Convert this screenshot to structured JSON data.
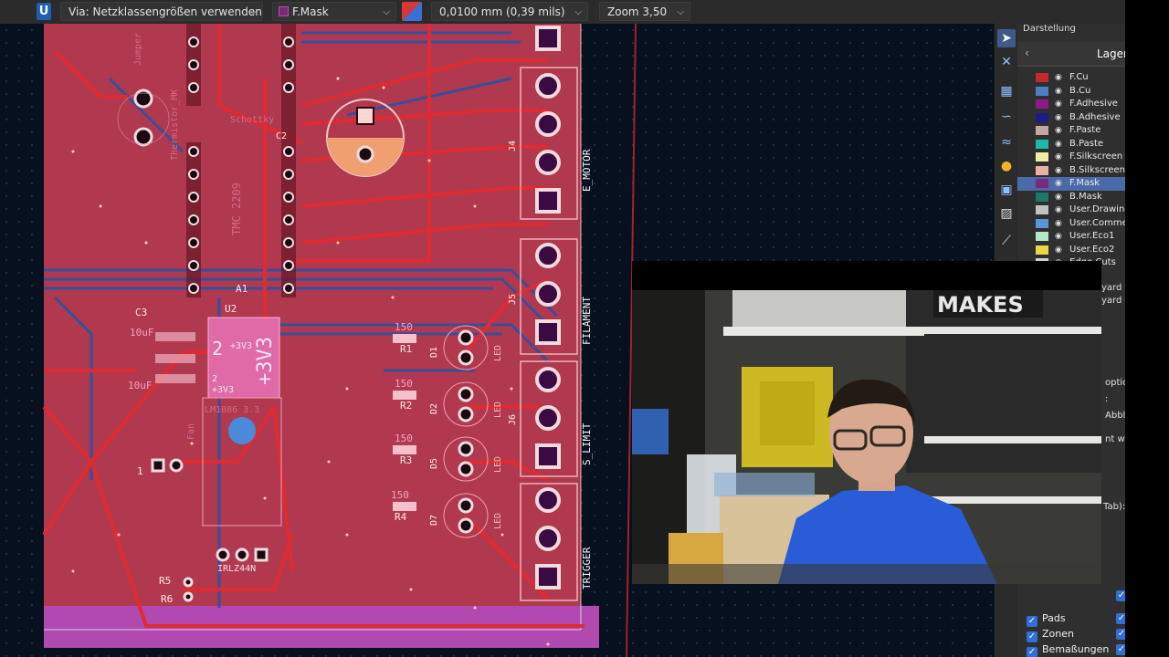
{
  "toolbar": {
    "app_icon": "U",
    "via_combo": "Via: Netzklassengrößen verwenden",
    "layer_combo": "F.Mask",
    "layer_swatch_color": "#7b2a7b",
    "grid_combo": "0,0100 mm (0,39 mils)",
    "zoom_combo": "Zoom 3,50"
  },
  "board": {
    "connector_labels": [
      "E_MOTOR",
      "FILAMENT",
      "S_LIMIT",
      "TRIGGER"
    ],
    "connector_refs": [
      "J4",
      "J5",
      "J6"
    ],
    "silk_labels": [
      "TMC 2209",
      "Thermistor_MK",
      "Jumper",
      "Schottky",
      "LM1086 3.3",
      "Fan",
      "IRLZ44N"
    ],
    "ic_marks": [
      "2",
      "+3V3",
      "+3V3",
      "2",
      "+3V3"
    ],
    "ic_ref": "U2",
    "misc_refs": [
      "A1",
      "C3",
      "C2",
      "10uF",
      "10uF",
      "1"
    ],
    "resistors": [
      {
        "ref": "R1",
        "value": "150"
      },
      {
        "ref": "R2",
        "value": "150"
      },
      {
        "ref": "R3",
        "value": "150"
      },
      {
        "ref": "R4",
        "value": "150"
      },
      {
        "ref": "R5",
        "value": ""
      },
      {
        "ref": "R6",
        "value": ""
      }
    ],
    "leds": [
      {
        "ref": "D1",
        "label": "LED"
      },
      {
        "ref": "D2",
        "label": "LED"
      },
      {
        "ref": "D5",
        "label": "LED"
      },
      {
        "ref": "D7",
        "label": "LED"
      }
    ]
  },
  "panel": {
    "title": "Darstellung",
    "tab": "Lagen",
    "layers": [
      {
        "name": "F.Cu",
        "color": "#c8282d"
      },
      {
        "name": "B.Cu",
        "color": "#4d7fc4"
      },
      {
        "name": "F.Adhesive",
        "color": "#8b1a8b"
      },
      {
        "name": "B.Adhesive",
        "color": "#1b1b8a"
      },
      {
        "name": "F.Paste",
        "color": "#c9a4a4"
      },
      {
        "name": "B.Paste",
        "color": "#1db8a9"
      },
      {
        "name": "F.Silkscreen",
        "color": "#f2eda1"
      },
      {
        "name": "B.Silkscreen",
        "color": "#e8b2a7"
      },
      {
        "name": "F.Mask",
        "color": "#7b2a7b"
      },
      {
        "name": "B.Mask",
        "color": "#1a7a6a"
      },
      {
        "name": "User.Drawings",
        "color": "#c2c2c2"
      },
      {
        "name": "User.Comments",
        "color": "#5994dc"
      },
      {
        "name": "User.Eco1",
        "color": "#b5e8c8"
      },
      {
        "name": "User.Eco2",
        "color": "#e8d54a"
      },
      {
        "name": "Edge.Cuts",
        "color": "#d0d0d0"
      }
    ],
    "fragments": [
      "yard",
      "yard",
      "optio",
      ":",
      "Abble",
      "nt we",
      "Tab):"
    ],
    "checkboxes": [
      "Pads",
      "Zonen",
      "Bemaßungen"
    ]
  }
}
